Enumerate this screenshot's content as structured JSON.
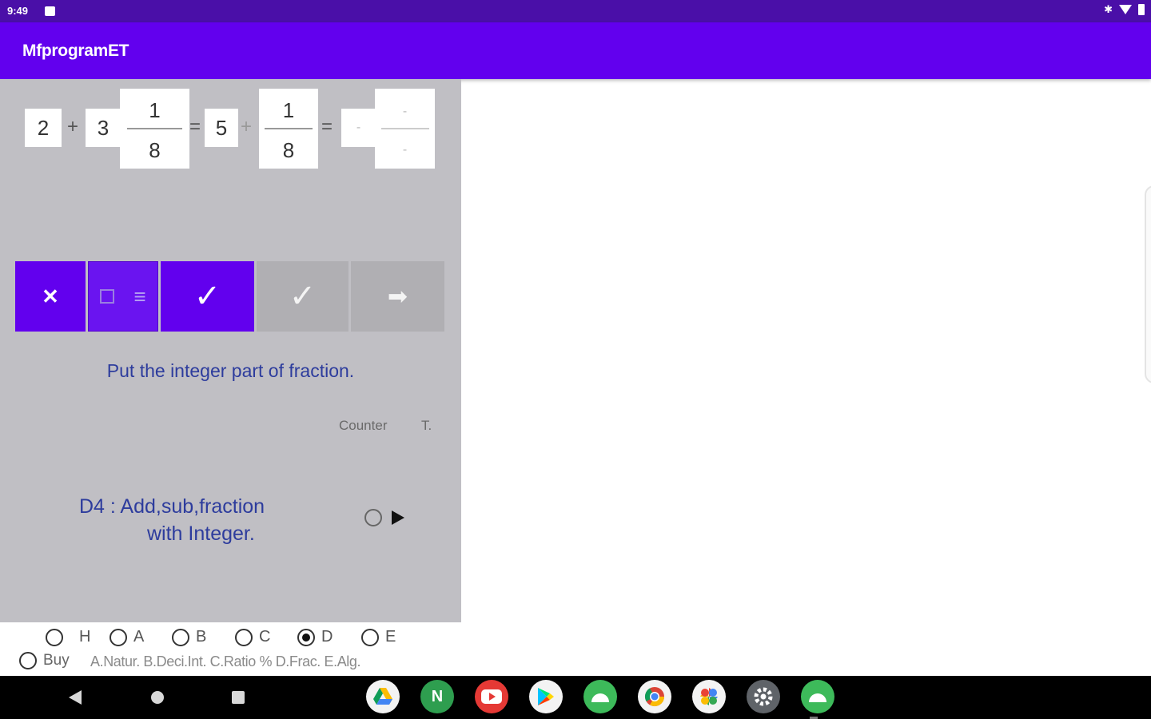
{
  "status": {
    "time": "9:49"
  },
  "app": {
    "title": "MfprogramET"
  },
  "equation": {
    "int1": "2",
    "plus1": "+",
    "int2": "3",
    "frac1": {
      "num": "1",
      "den": "8"
    },
    "eq1": "=",
    "int3": "5",
    "plus2": "+",
    "frac2": {
      "num": "1",
      "den": "8"
    },
    "eq2": "=",
    "answer": {
      "int": "-",
      "num": "-",
      "den": "-"
    }
  },
  "buttons": {
    "clear": "✕",
    "eq": "≡",
    "check_active": "✓",
    "check_grey": "✓",
    "next": "➡"
  },
  "hint": "Put the integer part of fraction.",
  "counter_label": "Counter",
  "t_label": "T.",
  "level": {
    "line1": "D4 :  Add,sub,fraction",
    "line2": "with Integer."
  },
  "radios": [
    {
      "label": "H",
      "selected": false
    },
    {
      "label": "A",
      "selected": false
    },
    {
      "label": "B",
      "selected": false
    },
    {
      "label": "C",
      "selected": false
    },
    {
      "label": "D",
      "selected": true
    },
    {
      "label": "E",
      "selected": false
    }
  ],
  "buy_label": "Buy",
  "legend": "A.Natur. B.Deci.Int. C.Ratio % D.Frac. E.Alg.",
  "dock_apps": [
    {
      "name": "drive",
      "icon": "drive-icon",
      "color": "#f3f3f3"
    },
    {
      "name": "n-app",
      "icon": "n-app-icon",
      "color": "#2e9e4f"
    },
    {
      "name": "youtube",
      "icon": "youtube-icon",
      "color": "#e53935"
    },
    {
      "name": "play-store",
      "icon": "play-store-icon",
      "color": "#f3f3f3"
    },
    {
      "name": "android",
      "icon": "android-icon",
      "color": "#3dba5a"
    },
    {
      "name": "chrome",
      "icon": "chrome-icon",
      "color": "#f3f3f3"
    },
    {
      "name": "photos",
      "icon": "photos-icon",
      "color": "#f3f3f3"
    },
    {
      "name": "settings",
      "icon": "settings-icon",
      "color": "#5f6368"
    },
    {
      "name": "android-2",
      "icon": "android-icon",
      "color": "#3dba5a"
    }
  ],
  "colors": {
    "accent": "#6200ee",
    "statusbar": "#4a0fa8",
    "panel": "#c0bfc4",
    "text_blue": "#2d3c9d"
  }
}
